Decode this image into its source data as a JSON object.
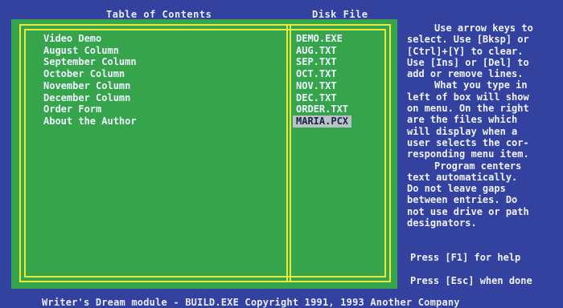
{
  "header": {
    "contents_title": "Table of Contents",
    "files_title": "Disk File"
  },
  "menu_items": [
    "Video Demo",
    "August Column",
    "September Column",
    "October Column",
    "November Column",
    "December Column",
    "Order Form",
    "About the Author"
  ],
  "file_items": [
    "DEMO.EXE",
    "AUG.TXT",
    "SEP.TXT",
    "OCT.TXT",
    "NOV.TXT",
    "DEC.TXT",
    "ORDER.TXT",
    "MARIA.PCX"
  ],
  "help_lines": [
    "Use arrow keys to",
    "select. Use [Bksp] or",
    "[Ctrl]+[Y] to clear.",
    "Use [Ins] or [Del] to",
    "add or remove lines.",
    "What you type in",
    "left of box will show",
    "on menu. On the right",
    "are the files which",
    "will display when a",
    "user selects the cor-",
    "responding menu item.",
    "Program centers",
    "text automatically.",
    "Do not leave gaps",
    "between entries. Do",
    "not use drive or path",
    "designators."
  ],
  "hints": {
    "help": "Press [F1] for help",
    "done": "Press [Esc] when done"
  },
  "footer": "Writer's Dream module - BUILD.EXE Copyright 1991, 1993 Another Company",
  "colors": {
    "background": "#33419f",
    "panel": "#35a44a",
    "frame": "#e7ea3c",
    "selection": "#b9c2c9"
  }
}
